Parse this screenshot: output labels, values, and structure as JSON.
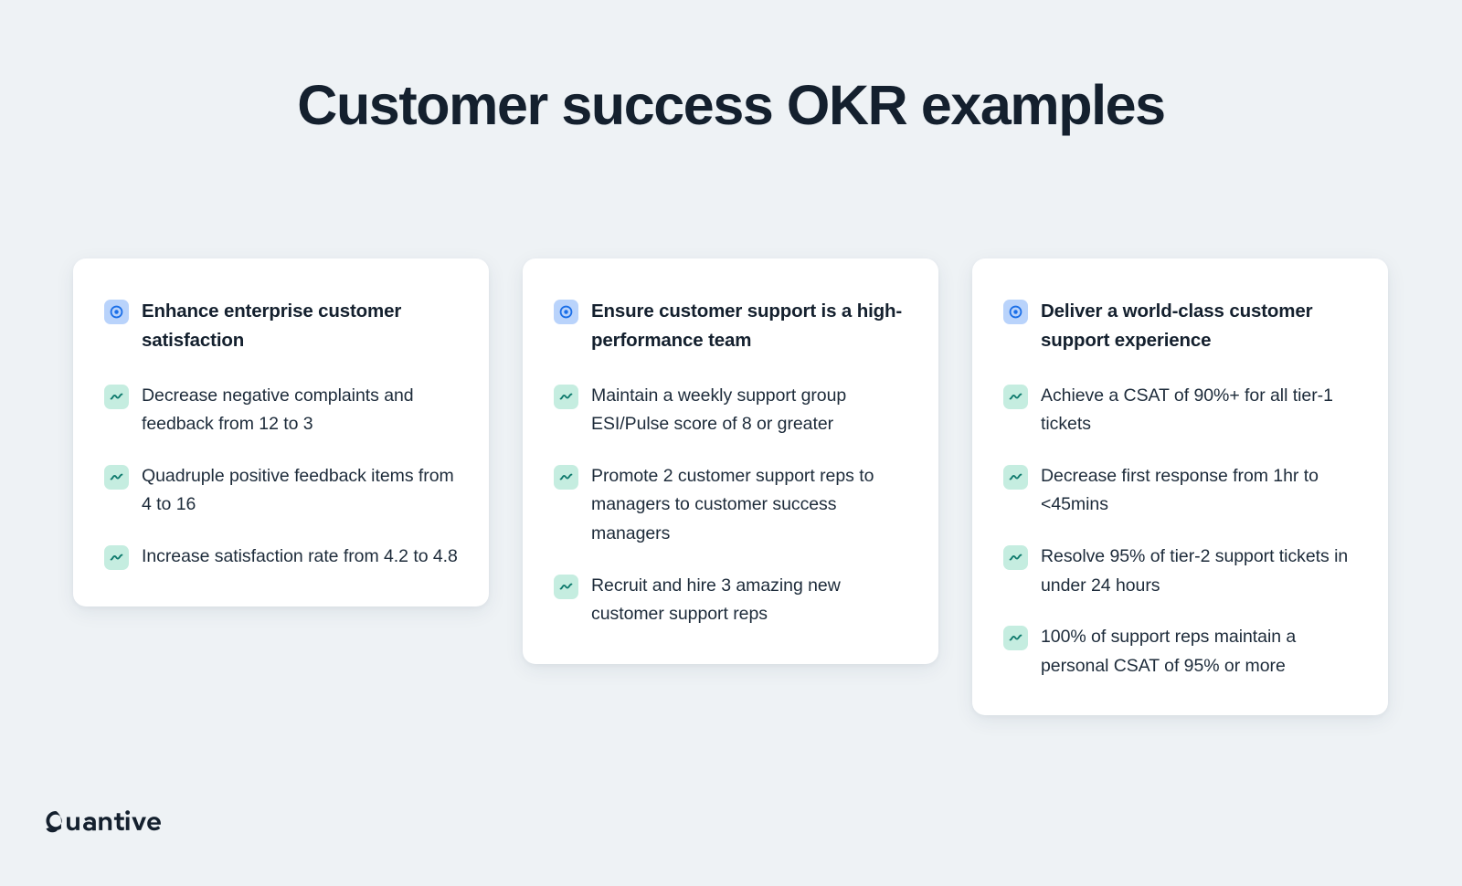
{
  "page": {
    "title": "Customer success OKR examples",
    "background_color": "#eef2f5",
    "text_color": "#14202e"
  },
  "icons": {
    "objective": {
      "name": "objective-target-icon",
      "tile_color": "#b9d3fb",
      "glyph_color": "#1b6fe8"
    },
    "key_result": {
      "name": "key-result-trend-icon",
      "tile_color": "#c5ede0",
      "glyph_color": "#0f7a6d"
    }
  },
  "cards": [
    {
      "objective": "Enhance enterprise customer satisfaction",
      "key_results": [
        "Decrease negative complaints and feedback from 12 to 3",
        "Quadruple positive feedback items from 4 to 16",
        "Increase satisfaction rate from 4.2 to 4.8"
      ]
    },
    {
      "objective": "Ensure customer support is a high-performance team",
      "key_results": [
        "Maintain a weekly support group ESI/Pulse score of 8 or greater",
        "Promote 2 customer support reps to managers to customer success managers",
        "Recruit and hire 3 amazing new customer support reps"
      ]
    },
    {
      "objective": "Deliver a world-class customer support experience",
      "key_results": [
        "Achieve a CSAT of 90%+ for all tier-1 tickets",
        "Decrease first response from 1hr to <45mins",
        "Resolve 95% of tier-2 support tickets in under 24 hours",
        "100% of support reps maintain a personal CSAT of 95% or more"
      ]
    }
  ],
  "footer": {
    "brand": "Quantive"
  }
}
